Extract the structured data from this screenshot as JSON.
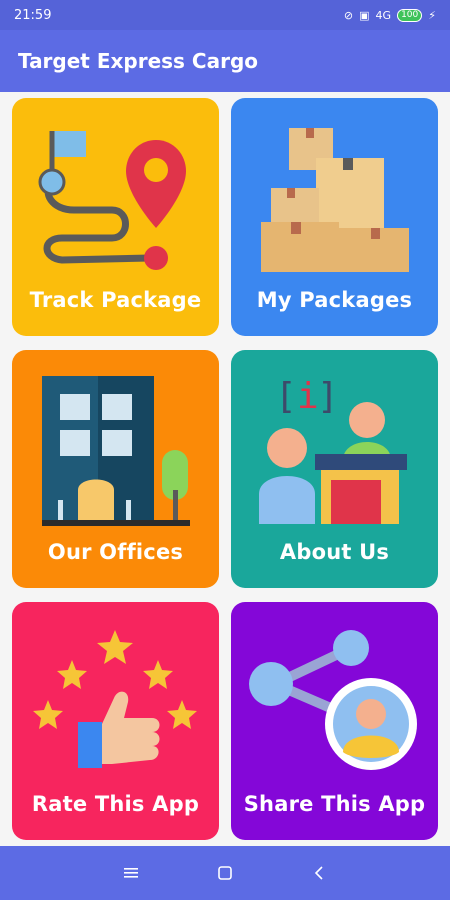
{
  "status_bar": {
    "time": "21:59",
    "network": "4G",
    "battery": "100",
    "charging_icon": "bolt-icon"
  },
  "app_bar": {
    "title": "Target Express Cargo"
  },
  "cards": [
    {
      "label": "Track Package",
      "color": "#fbbd0c",
      "icon": "map-pin-route-icon"
    },
    {
      "label": "My Packages",
      "color": "#3b87f0",
      "icon": "boxes-icon"
    },
    {
      "label": "Our Offices",
      "color": "#fb8a07",
      "icon": "office-building-icon"
    },
    {
      "label": "About Us",
      "color": "#1aa79b",
      "icon": "reception-desk-icon"
    },
    {
      "label": "Rate This App",
      "color": "#f7255e",
      "icon": "thumbs-up-stars-icon"
    },
    {
      "label": "Share This App",
      "color": "#8407d8",
      "icon": "share-network-icon"
    }
  ],
  "nav_bar": {
    "menu_icon": "menu-icon",
    "home_icon": "home-square-icon",
    "back_icon": "back-chevron-icon"
  }
}
